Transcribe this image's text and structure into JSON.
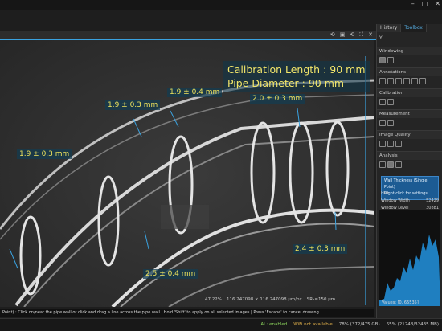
{
  "viewer": {
    "calibration": [
      "Calibration Length : 90 mm",
      "Pipe Diameter : 90 mm"
    ],
    "measurements": [
      "1.9 ± 0.4 mm",
      "1.9 ± 0.3 mm",
      "2.0 ± 0.3 mm",
      "1.9 ± 0.3 mm",
      "2.4 ± 0.3 mm",
      "2.5 ± 0.4 mm"
    ],
    "status": {
      "zoom": "47.22%",
      "pixel_size": "116.247098 × 116.247098 µm/px",
      "sr": "SRₑ=150 µm"
    },
    "hint": "Point) : Click on/near the pipe wall or click and drag a line across the pipe wall | Hold 'Shift' to apply on all selected images | Press 'Escape' to cancel drawing"
  },
  "panel": {
    "tabs": [
      "History",
      "Toolbox"
    ],
    "sections": [
      "Windowing",
      "Annotations",
      "Calibration",
      "Measurement",
      "Image Quality",
      "Analysis"
    ],
    "tooltip": [
      "Wall Thickness (Single Point)",
      "Right-click for settings"
    ],
    "histogram_label": "Hist",
    "window_width_label": "Window Width",
    "window_width_value": "52429",
    "window_level_label": "Window Level (Center)",
    "window_level_value": "30881",
    "hist_range": "Values: [0, 65535]",
    "y_label": "Y"
  },
  "taskbar": {
    "ai": "AI : enabled",
    "wifi": "WiFi not available",
    "mem": "78% (372/475 GB)",
    "cpu": "65% (21248/32435 MB)"
  }
}
